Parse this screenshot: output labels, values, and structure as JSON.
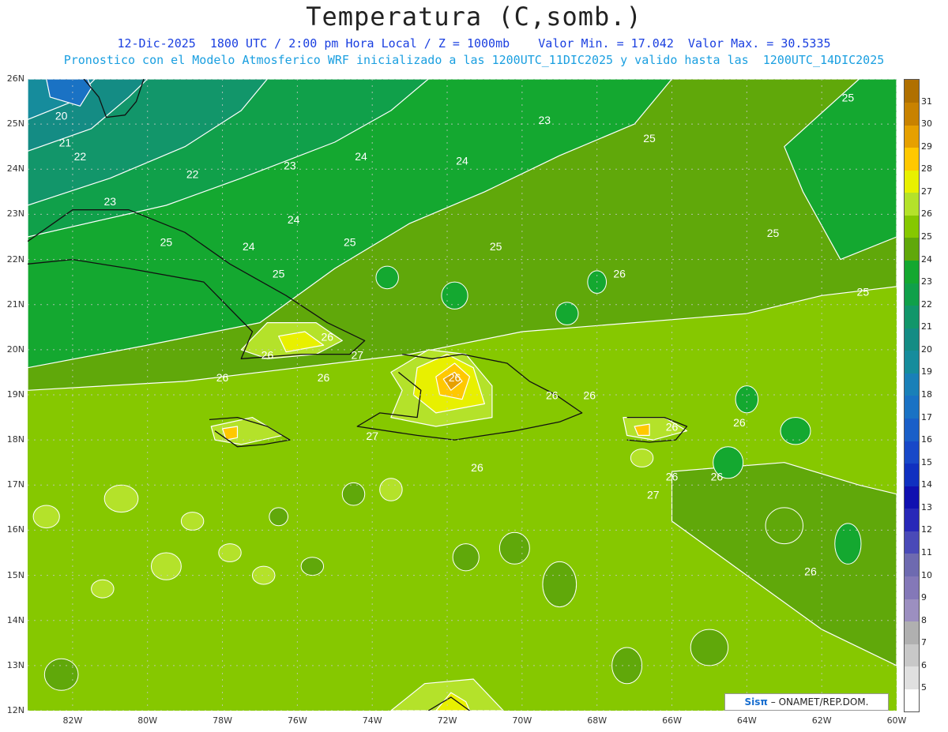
{
  "title": "Temperatura (C,somb.)",
  "subtitle1": "12-Dic-2025  1800 UTC / 2:00 pm Hora Local / Z = 1000mb    Valor Min. = 17.042  Valor Max. = 30.5335",
  "subtitle2": "Pronostico con el Modelo Atmosferico WRF inicializado a las 1200UTC_11DIC2025 y valido hasta las  1200UTC_14DIC2025",
  "credit": {
    "brand": "Sisπ",
    "text": "– ONAMET/REP.DOM."
  },
  "chart_data": {
    "type": "heatmap",
    "variable": "Temperatura (C,somb.)",
    "level": "Z = 1000mb",
    "min_value": 17.042,
    "max_value": 30.5335,
    "lat_ticks": [
      "26N",
      "25N",
      "24N",
      "23N",
      "22N",
      "21N",
      "20N",
      "19N",
      "18N",
      "17N",
      "16N",
      "15N",
      "14N",
      "13N",
      "12N"
    ],
    "lon_ticks": [
      "82W",
      "80W",
      "78W",
      "76W",
      "74W",
      "72W",
      "70W",
      "68W",
      "66W",
      "64W",
      "62W",
      "60W"
    ],
    "lon_range": [
      -83.2,
      -60
    ],
    "lat_range": [
      12,
      26
    ],
    "grid": true,
    "contour_labels": [
      "20",
      "21",
      "22",
      "22",
      "23",
      "23",
      "23",
      "24",
      "24",
      "24",
      "24",
      "25",
      "25",
      "25",
      "25",
      "25",
      "25",
      "25",
      "25",
      "26",
      "26",
      "26",
      "26",
      "26",
      "26",
      "26",
      "26",
      "26",
      "26",
      "26",
      "26",
      "26",
      "26",
      "27",
      "27",
      "27"
    ],
    "colorbar": {
      "levels": [
        "5",
        "6",
        "7",
        "8",
        "9",
        "10",
        "11",
        "12",
        "13",
        "14",
        "15",
        "16",
        "17",
        "18",
        "19",
        "20",
        "21",
        "22",
        "23",
        "24",
        "25",
        "26",
        "27",
        "28",
        "29",
        "30",
        "31"
      ],
      "colors": [
        "#ffffff",
        "#e0e0e0",
        "#c8c8c8",
        "#b0b0b0",
        "#9c8fc0",
        "#8478b8",
        "#6e6ab0",
        "#4a4ab8",
        "#2828b8",
        "#1010b0",
        "#1030c0",
        "#1848c8",
        "#1a5fc8",
        "#1a72c4",
        "#1a80b8",
        "#168c9c",
        "#148c84",
        "#12966a",
        "#10a04a",
        "#14a830",
        "#60a80a",
        "#86c800",
        "#b4e22a",
        "#e8f000",
        "#ffc800",
        "#e6a000",
        "#c88200",
        "#b07000"
      ]
    }
  }
}
